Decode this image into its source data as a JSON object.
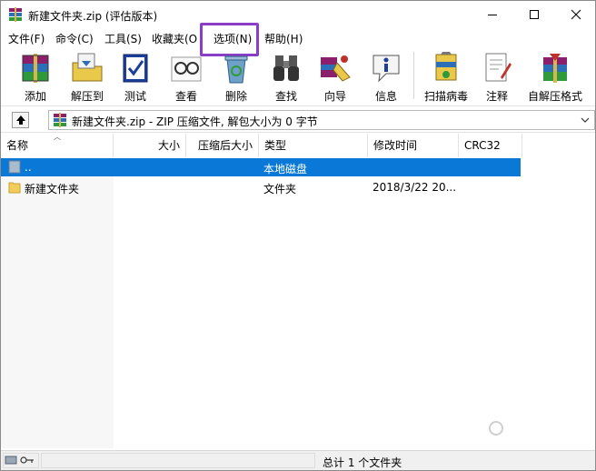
{
  "window": {
    "title": "新建文件夹.zip (评估版本)"
  },
  "menu": {
    "items": [
      {
        "label": "文件(F)"
      },
      {
        "label": "命令(C)"
      },
      {
        "label": "工具(S)"
      },
      {
        "label": "收藏夹(O"
      },
      {
        "label": "选项(N)"
      },
      {
        "label": "帮助(H)"
      }
    ]
  },
  "toolbar": {
    "add": "添加",
    "extract_to": "解压到",
    "test": "测试",
    "view": "查看",
    "delete": "删除",
    "find": "查找",
    "wizard": "向导",
    "info": "信息",
    "virus_scan": "扫描病毒",
    "comment": "注释",
    "sfx": "自解压格式"
  },
  "address": {
    "path": "新建文件夹.zip - ZIP 压缩文件, 解包大小为 0 字节"
  },
  "list": {
    "columns": {
      "name": "名称",
      "size": "大小",
      "packed": "压缩后大小",
      "type": "类型",
      "modified": "修改时间",
      "crc": "CRC32"
    },
    "rows": [
      {
        "name": "..",
        "type": "本地磁盘",
        "modified": ""
      },
      {
        "name": "新建文件夹",
        "type": "文件夹",
        "modified": "2018/3/22 20..."
      }
    ]
  },
  "status": {
    "summary": "总计 1 个文件夹"
  },
  "colors": {
    "selection": "#0a78d7",
    "highlight_box": "#8a3ec8"
  }
}
